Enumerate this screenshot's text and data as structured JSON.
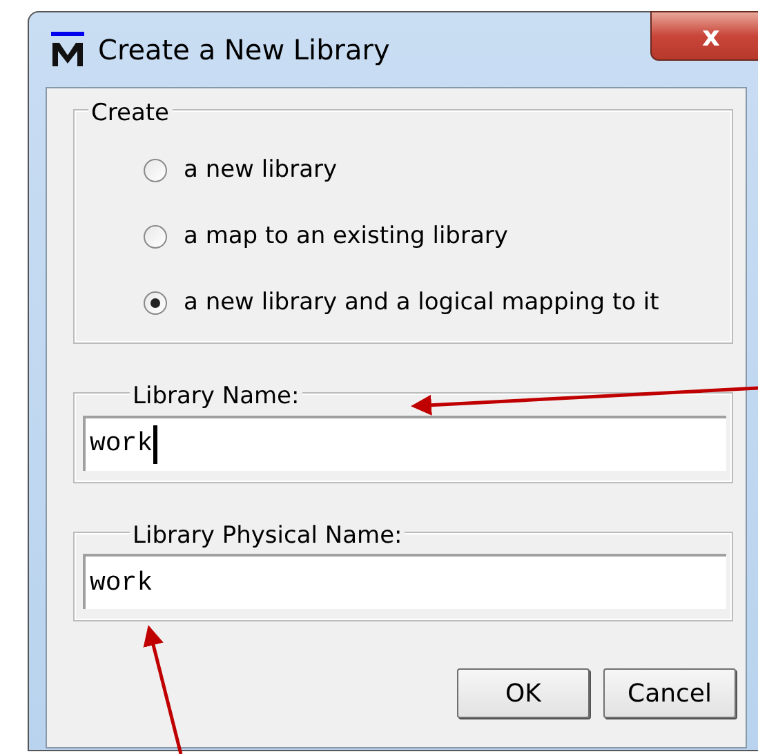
{
  "window": {
    "title": "Create a New Library",
    "close": "x"
  },
  "create_group": {
    "title": "Create",
    "options": [
      {
        "label": "a new library",
        "selected": false
      },
      {
        "label": "a map to an existing library",
        "selected": false
      },
      {
        "label": "a new library and a logical mapping to it",
        "selected": true
      }
    ]
  },
  "fields": [
    {
      "label": "Library Name:",
      "value": "work",
      "focused": true
    },
    {
      "label": "Library Physical Name:",
      "value": "work",
      "focused": false
    }
  ],
  "buttons": [
    "OK",
    "Cancel"
  ]
}
